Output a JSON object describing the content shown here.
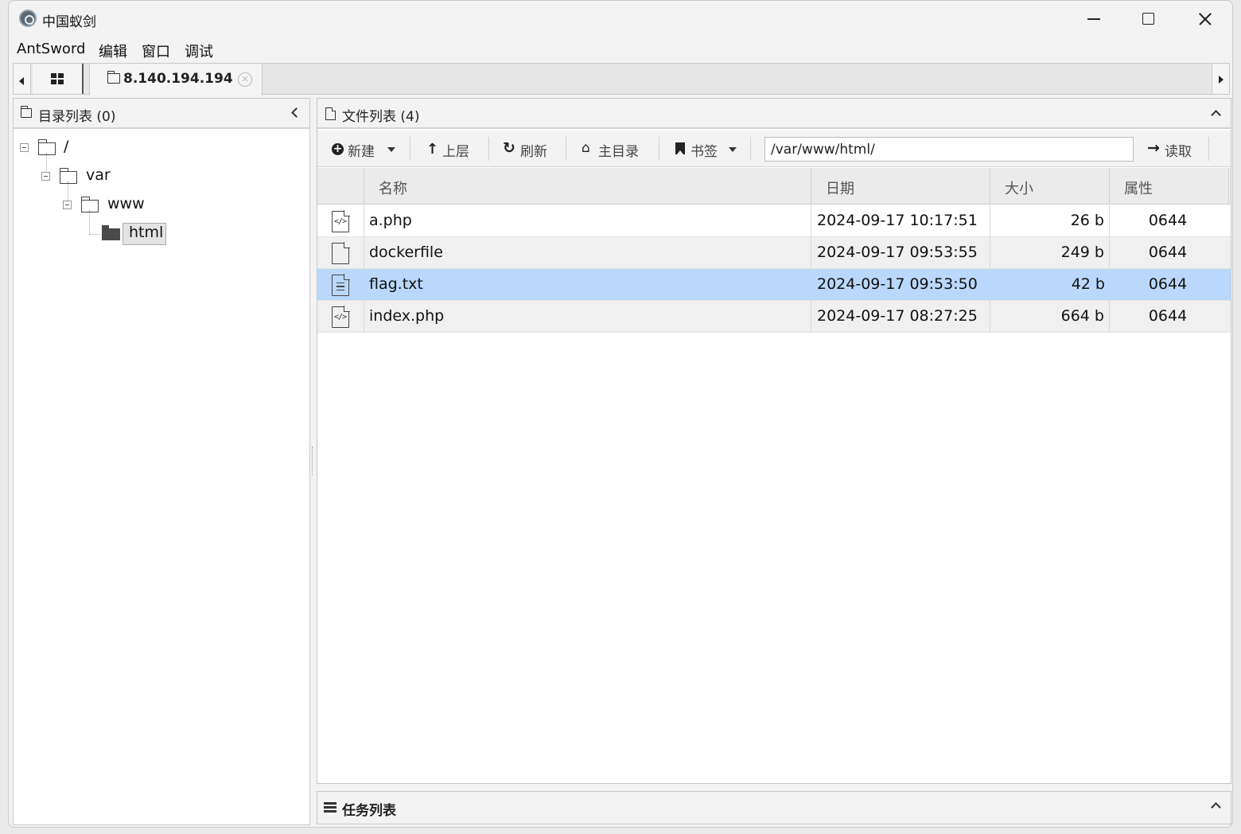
{
  "window": {
    "title": "中国蚁剑"
  },
  "menu": [
    "AntSword",
    "编辑",
    "窗口",
    "调试"
  ],
  "tabs": {
    "active_label": "8.140.194.194"
  },
  "left_panel": {
    "title": "目录列表 (0)",
    "tree": [
      {
        "label": "/",
        "icon": "folder-open-icon",
        "expanded": true
      },
      {
        "label": "var",
        "icon": "folder-open-icon",
        "expanded": true
      },
      {
        "label": "www",
        "icon": "folder-open-icon",
        "expanded": true
      },
      {
        "label": "html",
        "icon": "folder-filled-icon",
        "selected": true
      }
    ]
  },
  "right_panel": {
    "title": "文件列表 (4)",
    "toolbar": {
      "new": "新建",
      "up": "上层",
      "refresh": "刷新",
      "home": "主目录",
      "bookmarks": "书签",
      "path": "/var/www/html/",
      "read": "读取"
    },
    "columns": [
      "名称",
      "日期",
      "大小",
      "属性"
    ],
    "files": [
      {
        "name": "a.php",
        "date": "2024-09-17 10:17:51",
        "size": "26 b",
        "attr": "0644",
        "icon": "code-file-icon",
        "selected": false
      },
      {
        "name": "dockerfile",
        "date": "2024-09-17 09:53:55",
        "size": "249 b",
        "attr": "0644",
        "icon": "file-icon",
        "selected": false
      },
      {
        "name": "flag.txt",
        "date": "2024-09-17 09:53:50",
        "size": "42 b",
        "attr": "0644",
        "icon": "text-file-icon",
        "selected": true
      },
      {
        "name": "index.php",
        "date": "2024-09-17 08:27:25",
        "size": "664 b",
        "attr": "0644",
        "icon": "code-file-icon",
        "selected": false
      }
    ]
  },
  "task_panel": {
    "title": "任务列表"
  },
  "colors": {
    "selection": "#b9d8fb",
    "window_bg": "#f3f3f3"
  }
}
